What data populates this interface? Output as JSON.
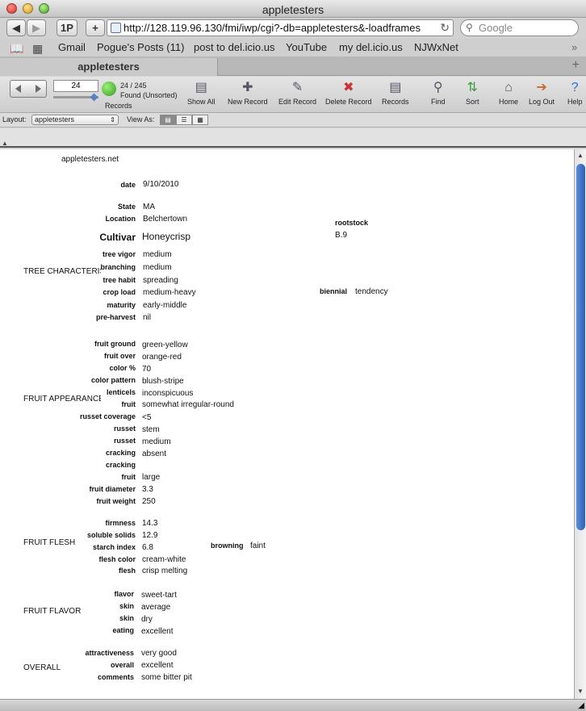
{
  "window": {
    "title": "appletesters"
  },
  "browser": {
    "back": "◀",
    "forward": "▶",
    "onep": "1P",
    "add": "+",
    "url": "http://128.119.96.130/fmi/iwp/cgi?-db=appletesters&-loadframes",
    "reload": "↻",
    "search_placeholder": "Google"
  },
  "bookmarks": [
    "Gmail",
    "Pogue's Posts (11)",
    "post to del.icio.us",
    "YouTube",
    "my del.icio.us",
    "NJWxNet"
  ],
  "bookmarks_more": "»",
  "tab": {
    "title": "appletesters",
    "add": "+"
  },
  "fm_toolbar": {
    "record_number": "24",
    "found_count": "24 / 245",
    "found_status": "Found (Unsorted)",
    "records_label": "Records",
    "tools": [
      "Show All",
      "New Record",
      "Edit Record",
      "Delete Record",
      "Records",
      "Find",
      "Sort",
      "Home",
      "Log Out",
      "Help"
    ]
  },
  "layout_bar": {
    "label": "Layout:",
    "selected": "appletesters",
    "view_as": "View As:"
  },
  "record": {
    "site": "appletesters.net",
    "date_label": "date",
    "date": "9/10/2010",
    "state_label": "State",
    "state": "MA",
    "location_label": "Location",
    "location": "Belchertown",
    "rootstock_label": "rootstock",
    "rootstock": "B.9",
    "cultivar_label": "Cultivar",
    "cultivar": "Honeycrisp",
    "tree": {
      "section": "TREE CHARACTERISTICS",
      "fields": [
        {
          "label": "tree vigor",
          "value": "medium"
        },
        {
          "label": "branching",
          "value": "medium"
        },
        {
          "label": "tree habit",
          "value": "spreading"
        },
        {
          "label": "crop load",
          "value": "medium-heavy"
        },
        {
          "label": "maturity",
          "value": "early-middle"
        },
        {
          "label": "pre-harvest",
          "value": "nil"
        }
      ],
      "biennial_label": "biennial",
      "biennial": "tendency"
    },
    "appearance": {
      "section": "FRUIT APPEARANCE",
      "fields": [
        {
          "label": "fruit ground",
          "value": "green-yellow"
        },
        {
          "label": "fruit over",
          "value": "orange-red"
        },
        {
          "label": "color %",
          "value": "70"
        },
        {
          "label": "color pattern",
          "value": "blush-stripe"
        },
        {
          "label": "lenticels",
          "value": "inconspicuous"
        },
        {
          "label": "fruit",
          "value": "somewhat irregular-round"
        },
        {
          "label": "russet coverage",
          "value": "<5"
        },
        {
          "label": "russet",
          "value": "stem"
        },
        {
          "label": "russet",
          "value": "medium"
        },
        {
          "label": "cracking",
          "value": "absent"
        },
        {
          "label": "cracking",
          "value": ""
        },
        {
          "label": "fruit",
          "value": "large"
        },
        {
          "label": "fruit diameter",
          "value": "3.3"
        },
        {
          "label": "fruit weight",
          "value": "250"
        }
      ]
    },
    "flesh": {
      "section": "FRUIT FLESH",
      "fields": [
        {
          "label": "firmness",
          "value": "14.3"
        },
        {
          "label": "soluble solids",
          "value": "12.9"
        },
        {
          "label": "starch index",
          "value": "6.8"
        },
        {
          "label": "flesh color",
          "value": "cream-white"
        },
        {
          "label": "flesh",
          "value": "crisp melting"
        }
      ],
      "browning_label": "browning",
      "browning": "faint"
    },
    "flavor": {
      "section": "FRUIT FLAVOR",
      "fields": [
        {
          "label": "flavor",
          "value": "sweet-tart"
        },
        {
          "label": "skin",
          "value": "average"
        },
        {
          "label": "skin",
          "value": "dry"
        },
        {
          "label": "eating",
          "value": "excellent"
        }
      ]
    },
    "overall": {
      "section": "OVERALL",
      "fields": [
        {
          "label": "attractiveness",
          "value": "very good"
        },
        {
          "label": "overall",
          "value": "excellent"
        },
        {
          "label": "comments",
          "value": "some bitter pit"
        }
      ]
    }
  }
}
